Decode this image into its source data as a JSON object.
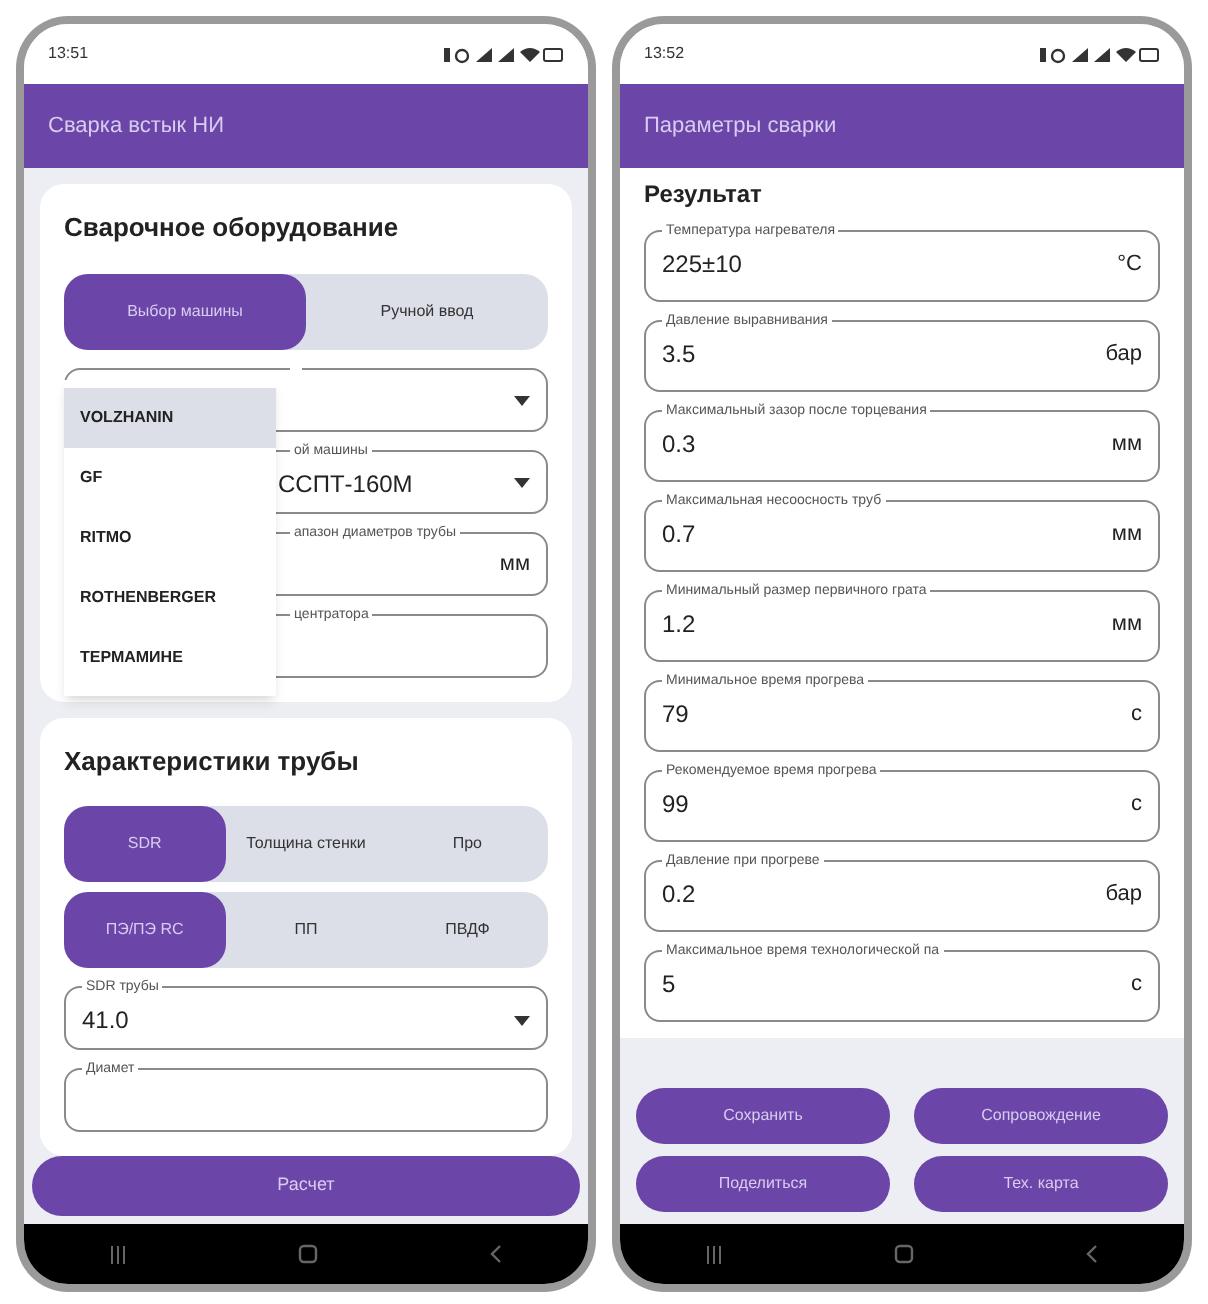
{
  "phones": [
    {
      "status_bar": {
        "time": "13:51"
      },
      "app_bar": {
        "title": "Сварка встык НИ"
      },
      "sections": [
        {
          "kind": "card",
          "title": "Сварочное оборудование",
          "segments": [
            [
              {
                "label": "Выбор машины",
                "selected": true
              },
              {
                "label": "Ручной ввод",
                "selected": false
              }
            ]
          ],
          "fields": [
            {
              "kind": "select"
            },
            {
              "kind": "select",
              "label": "ой машины",
              "value": "ССПТ-160М"
            },
            {
              "kind": "text",
              "label": "апазон диаметров трубы",
              "unit": "мм"
            },
            {
              "kind": "text",
              "label": "центратора"
            }
          ],
          "menu": {
            "open": true,
            "items": [
              {
                "label": "VOLZHANIN",
                "selected": true
              },
              {
                "label": "GF",
                "selected": false
              },
              {
                "label": "RITMO",
                "selected": false
              },
              {
                "label": "ROTHENBERGER",
                "selected": false
              },
              {
                "label": "ТЕРМАМИНЕ",
                "selected": false
              }
            ]
          }
        },
        {
          "kind": "card",
          "title": "Характеристики трубы",
          "segments": [
            [
              {
                "label": "SDR",
                "selected": true
              },
              {
                "label": "Толщина стенки",
                "selected": false
              },
              {
                "label": "Про",
                "selected": false
              }
            ],
            [
              {
                "label": "ПЭ/ПЭ RC",
                "selected": true
              },
              {
                "label": "ПП",
                "selected": false
              },
              {
                "label": "ПВДФ",
                "selected": false
              }
            ]
          ],
          "fields": [
            {
              "kind": "select",
              "label": "SDR трубы",
              "value": "41.0"
            },
            {
              "kind": "text",
              "label": "Диамет"
            }
          ]
        }
      ],
      "buttons": [
        "Расчет"
      ]
    },
    {
      "status_bar": {
        "time": "13:52"
      },
      "app_bar": {
        "title": "Параметры сварки"
      },
      "sections": [
        {
          "kind": "panel",
          "title": "Результат",
          "fields": [
            {
              "kind": "text",
              "label": "Температура нагревателя",
              "value": "225±10",
              "unit": "°С"
            },
            {
              "kind": "text",
              "label": "Давление выравнивания",
              "value": "3.5",
              "unit": "бар"
            },
            {
              "kind": "text",
              "label": "Максимальный зазор после торцевания",
              "value": "0.3",
              "unit": "мм"
            },
            {
              "kind": "text",
              "label": "Максимальная несоосность труб",
              "value": "0.7",
              "unit": "мм"
            },
            {
              "kind": "text",
              "label": "Минимальный размер первичного грата",
              "value": "1.2",
              "unit": "мм"
            },
            {
              "kind": "text",
              "label": "Минимальное время прогрева",
              "value": "79",
              "unit": "с"
            },
            {
              "kind": "text",
              "label": "Рекомендуемое время прогрева",
              "value": "99",
              "unit": "с"
            },
            {
              "kind": "text",
              "label": "Давление при прогреве",
              "value": "0.2",
              "unit": "бар"
            },
            {
              "kind": "text",
              "label": "Максимальное время технологической па",
              "value": "5",
              "unit": "с"
            }
          ]
        }
      ],
      "buttons": [
        "Сохранить",
        "Сопровождение",
        "Поделиться",
        "Тех. карта"
      ]
    }
  ]
}
